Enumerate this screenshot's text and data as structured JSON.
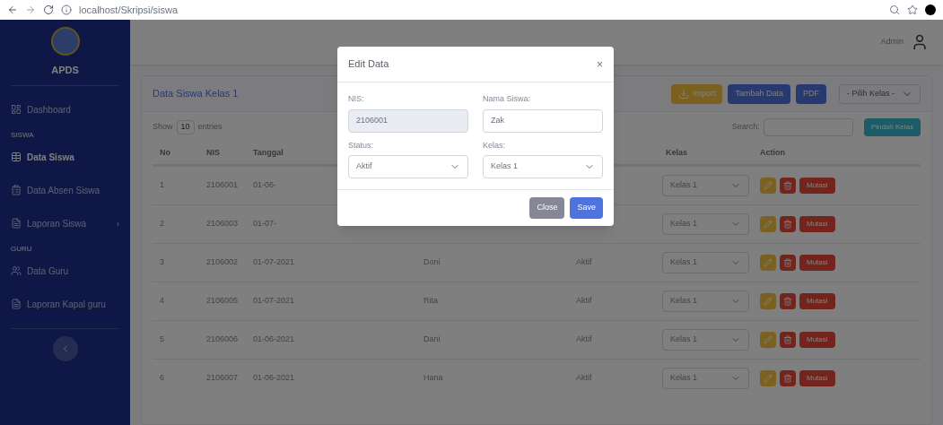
{
  "browser": {
    "url": "localhost/Skripsi/siswa"
  },
  "sidebar": {
    "brand": "APDS",
    "items": [
      {
        "kind": "link",
        "label": "Dashboard",
        "selected": false
      },
      {
        "kind": "heading",
        "label": "SISWA"
      },
      {
        "kind": "link",
        "label": "Data Siswa",
        "selected": true
      },
      {
        "kind": "link",
        "label": "Data Absen Siswa",
        "selected": false
      },
      {
        "kind": "link",
        "label": "Laporan Siswa",
        "selected": false,
        "chevron": "›"
      },
      {
        "kind": "heading",
        "label": "GURU"
      },
      {
        "kind": "link",
        "label": "Data Guru",
        "selected": false
      },
      {
        "kind": "link",
        "label": "Laporan Kapal guru",
        "selected": false
      }
    ]
  },
  "topbar": {
    "user": "Admin"
  },
  "card": {
    "title": "Data Siswa Kelas 1",
    "buttons": [
      {
        "kind": "warning",
        "label": "Import",
        "icon": true
      },
      {
        "kind": "primary",
        "label": "Tambah Data"
      },
      {
        "kind": "primary",
        "label": "PDF"
      }
    ],
    "class_select": "- Pilih Kelas -",
    "show_entries": {
      "before": "Show",
      "value": "10",
      "after": "entries"
    },
    "search_label": "Search:",
    "move_button": "Pindah Kelas"
  },
  "table": {
    "columns": [
      "No",
      "NIS",
      "Tanggal"
    ],
    "columns_right": [
      "Kelas",
      "Action"
    ],
    "rows": [
      {
        "no": "1",
        "nis": "2106001",
        "tanggal": "01-06-",
        "kelas": "Kelas 1",
        "mutate": "Mutasi"
      },
      {
        "no": "2",
        "nis": "2106003",
        "tanggal": "01-07-",
        "kelas": "Kelas 1",
        "mutate": "Mutasi"
      },
      {
        "no": "3",
        "nis": "2106002",
        "tanggal": "01-07-2021",
        "nama": "Doni",
        "status": "Aktif",
        "kelas": "Kelas 1",
        "mutate": "Mutasi"
      },
      {
        "no": "4",
        "nis": "2106005",
        "tanggal": "01-07-2021",
        "nama": "Rita",
        "status": "Aktif",
        "kelas": "Kelas 1",
        "mutate": "Mutasi"
      },
      {
        "no": "5",
        "nis": "2106006",
        "tanggal": "01-06-2021",
        "nama": "Dani",
        "status": "Aktif",
        "kelas": "Kelas 1",
        "mutate": "Mutasi"
      },
      {
        "no": "6",
        "nis": "2106007",
        "tanggal": "01-06-2021",
        "nama": "Hana",
        "status": "Aktif",
        "kelas": "Kelas 1",
        "mutate": "Mutasi"
      }
    ]
  },
  "modal": {
    "title": "Edit Data",
    "close": "×",
    "fields": [
      {
        "kind": "input",
        "label": "NIS:",
        "value": "2106001",
        "disabled": true
      },
      {
        "kind": "input",
        "label": "Nama Siswa:",
        "value": "Zak",
        "disabled": false
      },
      {
        "kind": "select",
        "label": "Status:",
        "value": "Aktif",
        "disabled": false
      },
      {
        "kind": "select",
        "label": "Kelas:",
        "value": "Kelas 1",
        "disabled": false
      }
    ],
    "buttons": [
      {
        "kind": "secondary",
        "label": "Close"
      },
      {
        "kind": "primary",
        "label": "Save"
      }
    ]
  }
}
